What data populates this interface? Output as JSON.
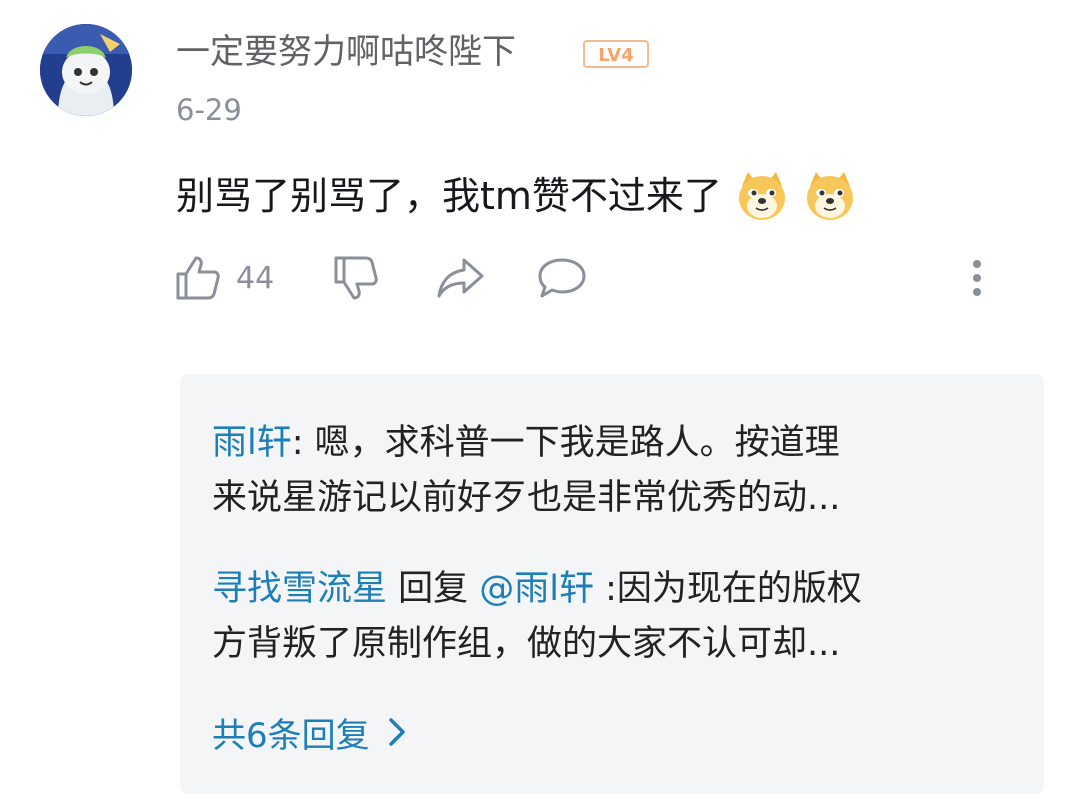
{
  "comment": {
    "username": "一定要努力啊咕咚陛下",
    "level_badge": "LV4",
    "date": "6-29",
    "text": "别骂了别骂了，我tm赞不过来了",
    "emoji": [
      "doge-emoji",
      "doge-emoji"
    ],
    "like_count": "44"
  },
  "replies": [
    {
      "author": "雨l轩",
      "separator": ": ",
      "line1": "嗯，求科普一下我是路人。按道理",
      "line2": "来说星游记以前好歹也是非常优秀的动..."
    },
    {
      "author": "寻找雪流星",
      "reply_word": " 回复 ",
      "mention": "@雨l轩",
      "line1": " :因为现在的版权",
      "line2": "方背叛了原制作组，做的大家不认可却..."
    }
  ],
  "more_replies_label": "共6条回复",
  "colors": {
    "link_blue": "#1d7fb8",
    "level_orange": "#f5b98e",
    "reply_bg": "#f4f5f7",
    "meta_gray": "#8a8f99"
  }
}
